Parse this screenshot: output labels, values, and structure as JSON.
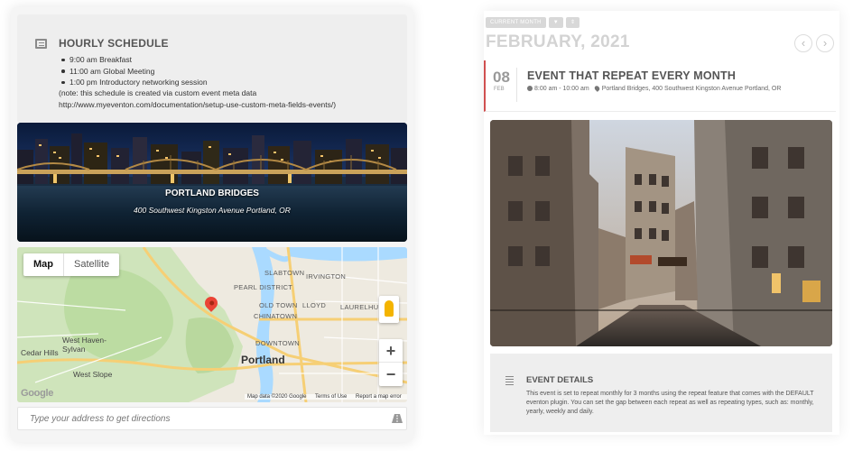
{
  "schedule": {
    "title": "HOURLY SCHEDULE",
    "icon": "schedule-list-icon",
    "items": [
      "9:00 am Breakfast",
      "11:00 am Global Meeting",
      "1:00 pm Introductory networking session"
    ],
    "note": "(note: this schedule is created via custom event meta data http://www.myeventon.com/documentation/setup-use-custom-meta-fields-events/)"
  },
  "location": {
    "name": "PORTLAND BRIDGES",
    "address": "400 Southwest Kingston Avenue Portland, OR"
  },
  "map": {
    "type_buttons": [
      "Map",
      "Satellite"
    ],
    "active_type": "Map",
    "labels": {
      "slabtown": "SLABTOWN",
      "pearl": "PEARL DISTRICT",
      "irvington": "IRVINGTON",
      "old_town": "OLD TOWN",
      "chinatown": "CHINATOWN",
      "lloyd": "LLOYD",
      "laurelhurst": "LAURELHURST",
      "downtown": "DOWNTOWN",
      "west_haven": "West Haven-Sylvan",
      "cedar_hills": "Cedar Hills",
      "west_slope": "West Slope",
      "portland": "Portland"
    },
    "zoom_in": "+",
    "zoom_out": "−",
    "logo": "Google",
    "footer": [
      "Map data ©2020 Google",
      "Terms of Use",
      "Report a map error"
    ],
    "colors": {
      "park": "#c8e2b0",
      "road": "#f9dc8c",
      "water": "#aadaff",
      "land": "#eeeae0"
    }
  },
  "directions": {
    "placeholder": "Type your address to get directions",
    "icon": "road-icon"
  },
  "calendar": {
    "toolbar": [
      "CURRENT MONTH",
      "filter-icon",
      "sort-icon"
    ],
    "month": "FEBRUARY, 2021",
    "prev": "‹",
    "next": "›"
  },
  "event": {
    "day": "08",
    "month_short": "FEB",
    "title": "EVENT THAT REPEAT EVERY MONTH",
    "time": "8:00 am - 10:00 am",
    "location": "Portland Bridges, 400 Southwest Kingston Avenue Portland, OR",
    "accent": "#d05050"
  },
  "details": {
    "title": "EVENT DETAILS",
    "text": "This event is set to repeat monthly for 3 months using the repeat feature that comes with the DEFAULT eventon plugin. You can set the gap between each repeat as well as repeating types, such as: monthly, yearly, weekly and daily."
  }
}
